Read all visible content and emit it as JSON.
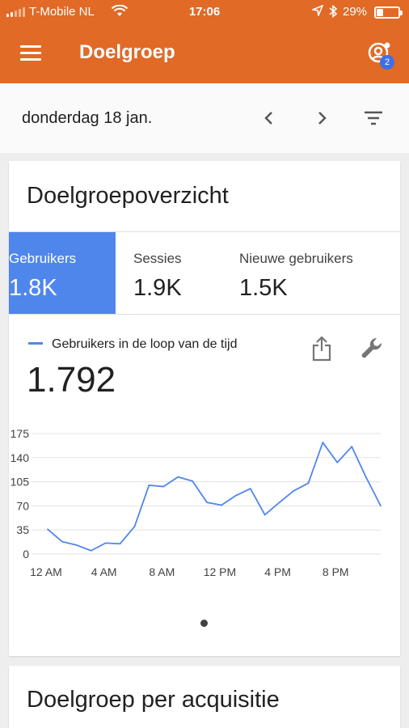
{
  "status_bar": {
    "carrier": "T-Mobile NL",
    "time": "17:06",
    "battery_text": "29%",
    "battery_level": 0.29
  },
  "app_bar": {
    "title": "Doelgroep",
    "menu_icon": "hamburger-menu-icon",
    "account_icon": "account-switch-icon",
    "badge_count": "2",
    "color": "#e06a26"
  },
  "date_bar": {
    "date": "donderdag 18 jan.",
    "prev_icon": "chevron-left-icon",
    "next_icon": "chevron-right-icon",
    "filter_icon": "filter-icon"
  },
  "overview": {
    "title": "Doelgroepoverzicht",
    "tabs": [
      {
        "label": "Gebruikers",
        "value": "1.8K",
        "active": true
      },
      {
        "label": "Sessies",
        "value": "1.9K",
        "active": false
      },
      {
        "label": "Nieuwe gebruikers",
        "value": "1.5K",
        "active": false
      }
    ],
    "legend": "Gebruikers in de loop van de tijd",
    "total": "1.792",
    "accent": "#4f86ec"
  },
  "chart_data": {
    "type": "line",
    "series": [
      {
        "name": "Gebruikers in de loop van de tijd",
        "x": [
          0,
          1,
          2,
          3,
          4,
          5,
          6,
          7,
          8,
          9,
          10,
          11,
          12,
          13,
          14,
          15,
          16,
          17,
          18,
          19,
          20,
          21,
          22,
          23
        ],
        "values": [
          36,
          18,
          13,
          5,
          16,
          15,
          40,
          100,
          98,
          112,
          106,
          75,
          71,
          85,
          95,
          57,
          75,
          92,
          103,
          162,
          133,
          156,
          111,
          70
        ]
      }
    ],
    "x_tick_labels": [
      "12 AM",
      "4 AM",
      "8 AM",
      "12 PM",
      "4 PM",
      "8 PM"
    ],
    "x_tick_positions": [
      0,
      4,
      8,
      12,
      16,
      20
    ],
    "y_ticks": [
      0,
      35,
      70,
      105,
      140,
      175
    ],
    "ylim": [
      0,
      175
    ],
    "xlim": [
      0,
      23
    ],
    "grid": true
  },
  "acquisition": {
    "title": "Doelgroep per acquisitie"
  }
}
